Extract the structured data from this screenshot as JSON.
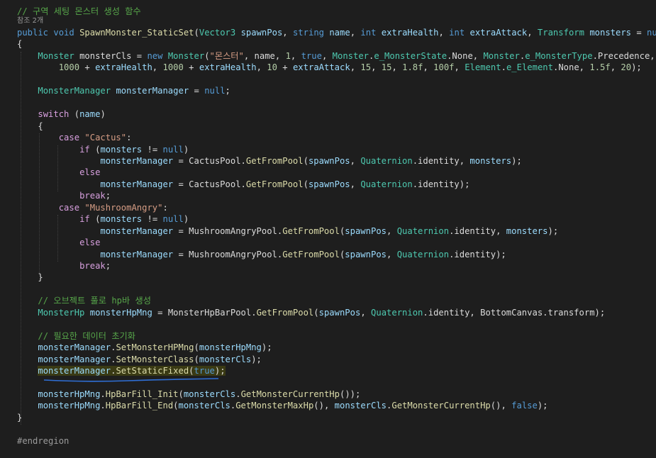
{
  "editor": {
    "codelens": "참조 2개",
    "line_groups": [
      {
        "name": "code-line-comment-region",
        "tokens": [
          [
            "c",
            "// 구역 세팅 몬스터 생성 함수"
          ]
        ]
      },
      {
        "name": "code-line-signature",
        "tokens": [
          [
            "k",
            "public"
          ],
          [
            "p",
            " "
          ],
          [
            "k",
            "void"
          ],
          [
            "p",
            " "
          ],
          [
            "m",
            "SpawnMonster_StaticSet"
          ],
          [
            "p",
            "("
          ],
          [
            "t",
            "Vector3"
          ],
          [
            "p",
            " "
          ],
          [
            "a",
            "spawnPos"
          ],
          [
            "p",
            ", "
          ],
          [
            "k",
            "string"
          ],
          [
            "p",
            " "
          ],
          [
            "a",
            "name"
          ],
          [
            "p",
            ", "
          ],
          [
            "k",
            "int"
          ],
          [
            "p",
            " "
          ],
          [
            "a",
            "extraHealth"
          ],
          [
            "p",
            ", "
          ],
          [
            "k",
            "int"
          ],
          [
            "p",
            " "
          ],
          [
            "a",
            "extraAttack"
          ],
          [
            "p",
            ", "
          ],
          [
            "t",
            "Transform"
          ],
          [
            "p",
            " "
          ],
          [
            "a",
            "monsters"
          ],
          [
            "p",
            " = "
          ],
          [
            "k",
            "null"
          ],
          [
            "p",
            ")"
          ]
        ]
      },
      {
        "name": "code-line-open-brace",
        "tokens": [
          [
            "p",
            "{"
          ]
        ]
      },
      {
        "name": "code-line-monster-new",
        "tokens": [
          [
            "p",
            "    "
          ],
          [
            "t",
            "Monster"
          ],
          [
            "p",
            " monsterCls = "
          ],
          [
            "k",
            "new"
          ],
          [
            "p",
            " "
          ],
          [
            "t",
            "Monster"
          ],
          [
            "p",
            "("
          ],
          [
            "s",
            "\"몬스터\""
          ],
          [
            "p",
            ", name, "
          ],
          [
            "n",
            "1"
          ],
          [
            "p",
            ", "
          ],
          [
            "k",
            "true"
          ],
          [
            "p",
            ", "
          ],
          [
            "t",
            "Monster"
          ],
          [
            "p",
            "."
          ],
          [
            "t",
            "e_MonsterState"
          ],
          [
            "p",
            ".None, "
          ],
          [
            "t",
            "Monster"
          ],
          [
            "p",
            "."
          ],
          [
            "t",
            "e_MonsterType"
          ],
          [
            "p",
            ".Precedence,"
          ]
        ]
      },
      {
        "name": "code-line-monster-args",
        "tokens": [
          [
            "p",
            "        "
          ],
          [
            "n",
            "1000"
          ],
          [
            "p",
            " + "
          ],
          [
            "a",
            "extraHealth"
          ],
          [
            "p",
            ", "
          ],
          [
            "n",
            "1000"
          ],
          [
            "p",
            " + "
          ],
          [
            "a",
            "extraHealth"
          ],
          [
            "p",
            ", "
          ],
          [
            "n",
            "10"
          ],
          [
            "p",
            " + "
          ],
          [
            "a",
            "extraAttack"
          ],
          [
            "p",
            ", "
          ],
          [
            "n",
            "15"
          ],
          [
            "p",
            ", "
          ],
          [
            "n",
            "15"
          ],
          [
            "p",
            ", "
          ],
          [
            "n",
            "1.8f"
          ],
          [
            "p",
            ", "
          ],
          [
            "n",
            "100f"
          ],
          [
            "p",
            ", "
          ],
          [
            "t",
            "Element"
          ],
          [
            "p",
            "."
          ],
          [
            "t",
            "e_Element"
          ],
          [
            "p",
            ".None, "
          ],
          [
            "n",
            "1.5f"
          ],
          [
            "p",
            ", "
          ],
          [
            "n",
            "20"
          ],
          [
            "p",
            ");"
          ]
        ]
      },
      {
        "name": "code-line-blank",
        "tokens": []
      },
      {
        "name": "code-line-manager-decl",
        "tokens": [
          [
            "p",
            "    "
          ],
          [
            "t",
            "MonsterManager"
          ],
          [
            "p",
            " "
          ],
          [
            "a",
            "monsterManager"
          ],
          [
            "p",
            " = "
          ],
          [
            "k",
            "null"
          ],
          [
            "p",
            ";"
          ]
        ]
      },
      {
        "name": "code-line-blank",
        "tokens": []
      },
      {
        "name": "code-line-switch",
        "tokens": [
          [
            "p",
            "    "
          ],
          [
            "r",
            "switch"
          ],
          [
            "p",
            " ("
          ],
          [
            "a",
            "name"
          ],
          [
            "p",
            ")"
          ]
        ]
      },
      {
        "name": "code-line-switch-open",
        "tokens": [
          [
            "p",
            "    {"
          ]
        ]
      },
      {
        "name": "code-line-case-cactus",
        "tokens": [
          [
            "p",
            "        "
          ],
          [
            "r",
            "case"
          ],
          [
            "p",
            " "
          ],
          [
            "s",
            "\"Cactus\""
          ],
          [
            "p",
            ":"
          ]
        ]
      },
      {
        "name": "code-line-if",
        "tokens": [
          [
            "p",
            "            "
          ],
          [
            "r",
            "if"
          ],
          [
            "p",
            " ("
          ],
          [
            "a",
            "monsters"
          ],
          [
            "p",
            " != "
          ],
          [
            "k",
            "null"
          ],
          [
            "p",
            ")"
          ]
        ]
      },
      {
        "name": "code-line-cactus-pool-1",
        "tokens": [
          [
            "p",
            "                "
          ],
          [
            "a",
            "monsterManager"
          ],
          [
            "p",
            " = CactusPool."
          ],
          [
            "m",
            "GetFromPool"
          ],
          [
            "p",
            "("
          ],
          [
            "a",
            "spawnPos"
          ],
          [
            "p",
            ", "
          ],
          [
            "t",
            "Quaternion"
          ],
          [
            "p",
            ".identity, "
          ],
          [
            "a",
            "monsters"
          ],
          [
            "p",
            ");"
          ]
        ]
      },
      {
        "name": "code-line-else",
        "tokens": [
          [
            "p",
            "            "
          ],
          [
            "r",
            "else"
          ]
        ]
      },
      {
        "name": "code-line-cactus-pool-2",
        "tokens": [
          [
            "p",
            "                "
          ],
          [
            "a",
            "monsterManager"
          ],
          [
            "p",
            " = CactusPool."
          ],
          [
            "m",
            "GetFromPool"
          ],
          [
            "p",
            "("
          ],
          [
            "a",
            "spawnPos"
          ],
          [
            "p",
            ", "
          ],
          [
            "t",
            "Quaternion"
          ],
          [
            "p",
            ".identity);"
          ]
        ]
      },
      {
        "name": "code-line-break",
        "tokens": [
          [
            "p",
            "            "
          ],
          [
            "r",
            "break"
          ],
          [
            "p",
            ";"
          ]
        ]
      },
      {
        "name": "code-line-case-mushroom",
        "tokens": [
          [
            "p",
            "        "
          ],
          [
            "r",
            "case"
          ],
          [
            "p",
            " "
          ],
          [
            "s",
            "\"MushroomAngry\""
          ],
          [
            "p",
            ":"
          ]
        ]
      },
      {
        "name": "code-line-if",
        "tokens": [
          [
            "p",
            "            "
          ],
          [
            "r",
            "if"
          ],
          [
            "p",
            " ("
          ],
          [
            "a",
            "monsters"
          ],
          [
            "p",
            " != "
          ],
          [
            "k",
            "null"
          ],
          [
            "p",
            ")"
          ]
        ]
      },
      {
        "name": "code-line-mushroom-pool-1",
        "tokens": [
          [
            "p",
            "                "
          ],
          [
            "a",
            "monsterManager"
          ],
          [
            "p",
            " = MushroomAngryPool."
          ],
          [
            "m",
            "GetFromPool"
          ],
          [
            "p",
            "("
          ],
          [
            "a",
            "spawnPos"
          ],
          [
            "p",
            ", "
          ],
          [
            "t",
            "Quaternion"
          ],
          [
            "p",
            ".identity, "
          ],
          [
            "a",
            "monsters"
          ],
          [
            "p",
            ");"
          ]
        ]
      },
      {
        "name": "code-line-else",
        "tokens": [
          [
            "p",
            "            "
          ],
          [
            "r",
            "else"
          ]
        ]
      },
      {
        "name": "code-line-mushroom-pool-2",
        "tokens": [
          [
            "p",
            "                "
          ],
          [
            "a",
            "monsterManager"
          ],
          [
            "p",
            " = MushroomAngryPool."
          ],
          [
            "m",
            "GetFromPool"
          ],
          [
            "p",
            "("
          ],
          [
            "a",
            "spawnPos"
          ],
          [
            "p",
            ", "
          ],
          [
            "t",
            "Quaternion"
          ],
          [
            "p",
            ".identity);"
          ]
        ]
      },
      {
        "name": "code-line-break",
        "tokens": [
          [
            "p",
            "            "
          ],
          [
            "r",
            "break"
          ],
          [
            "p",
            ";"
          ]
        ]
      },
      {
        "name": "code-line-switch-close",
        "tokens": [
          [
            "p",
            "    }"
          ]
        ]
      },
      {
        "name": "code-line-blank",
        "tokens": []
      },
      {
        "name": "code-line-comment-hpbar",
        "tokens": [
          [
            "p",
            "    "
          ],
          [
            "c",
            "// 오브젝트 풀로 hp바 생성"
          ]
        ]
      },
      {
        "name": "code-line-hpbar-pool",
        "tokens": [
          [
            "p",
            "    "
          ],
          [
            "t",
            "MonsterHp"
          ],
          [
            "p",
            " "
          ],
          [
            "a",
            "monsterHpMng"
          ],
          [
            "p",
            " = MonsterHpBarPool."
          ],
          [
            "m",
            "GetFromPool"
          ],
          [
            "p",
            "("
          ],
          [
            "a",
            "spawnPos"
          ],
          [
            "p",
            ", "
          ],
          [
            "t",
            "Quaternion"
          ],
          [
            "p",
            ".identity, BottomCanvas.transform);"
          ]
        ]
      },
      {
        "name": "code-line-blank",
        "tokens": []
      },
      {
        "name": "code-line-comment-init",
        "tokens": [
          [
            "p",
            "    "
          ],
          [
            "c",
            "// 필요한 데이터 초기화"
          ]
        ]
      },
      {
        "name": "code-line-set-hpmng",
        "tokens": [
          [
            "p",
            "    "
          ],
          [
            "a",
            "monsterManager"
          ],
          [
            "p",
            "."
          ],
          [
            "m",
            "SetMonsterHPMng"
          ],
          [
            "p",
            "("
          ],
          [
            "a",
            "monsterHpMng"
          ],
          [
            "p",
            ");"
          ]
        ]
      },
      {
        "name": "code-line-set-class",
        "tokens": [
          [
            "p",
            "    "
          ],
          [
            "a",
            "monsterManager"
          ],
          [
            "p",
            "."
          ],
          [
            "m",
            "SetMonsterClass"
          ],
          [
            "p",
            "("
          ],
          [
            "a",
            "monsterCls"
          ],
          [
            "p",
            ");"
          ]
        ]
      },
      {
        "name": "code-line-set-static-fixed",
        "highlight": true,
        "tokens": [
          [
            "p",
            "    "
          ],
          [
            "a",
            "monsterManager"
          ],
          [
            "p",
            "."
          ],
          [
            "m",
            "SetStaticFixed"
          ],
          [
            "p",
            "("
          ],
          [
            "k",
            "true"
          ],
          [
            "p",
            ");"
          ]
        ]
      },
      {
        "name": "code-line-blank",
        "tokens": []
      },
      {
        "name": "code-line-hpbar-init",
        "tokens": [
          [
            "p",
            "    "
          ],
          [
            "a",
            "monsterHpMng"
          ],
          [
            "p",
            "."
          ],
          [
            "m",
            "HpBarFill_Init"
          ],
          [
            "p",
            "("
          ],
          [
            "a",
            "monsterCls"
          ],
          [
            "p",
            "."
          ],
          [
            "m",
            "GetMonsterCurrentHp"
          ],
          [
            "p",
            "());"
          ]
        ]
      },
      {
        "name": "code-line-hpbar-end",
        "tokens": [
          [
            "p",
            "    "
          ],
          [
            "a",
            "monsterHpMng"
          ],
          [
            "p",
            "."
          ],
          [
            "m",
            "HpBarFill_End"
          ],
          [
            "p",
            "("
          ],
          [
            "a",
            "monsterCls"
          ],
          [
            "p",
            "."
          ],
          [
            "m",
            "GetMonsterMaxHp"
          ],
          [
            "p",
            "(), "
          ],
          [
            "a",
            "monsterCls"
          ],
          [
            "p",
            "."
          ],
          [
            "m",
            "GetMonsterCurrentHp"
          ],
          [
            "p",
            "(), "
          ],
          [
            "k",
            "false"
          ],
          [
            "p",
            ");"
          ]
        ]
      },
      {
        "name": "code-line-close-brace",
        "tokens": [
          [
            "p",
            "}"
          ]
        ]
      },
      {
        "name": "code-line-blank",
        "tokens": []
      },
      {
        "name": "code-line-endregion",
        "tokens": [
          [
            "x",
            "#endregion"
          ]
        ]
      }
    ]
  },
  "colors": {
    "background": "#1e1e1e",
    "comment": "#57a64a",
    "keyword": "#569cd6",
    "control": "#d8a0df",
    "type": "#4ec9b0",
    "method": "#dcdcaa",
    "string": "#d69d85",
    "number": "#b5cea8",
    "parameter": "#9cdcfe",
    "squiggle": "#2f6fd6"
  }
}
